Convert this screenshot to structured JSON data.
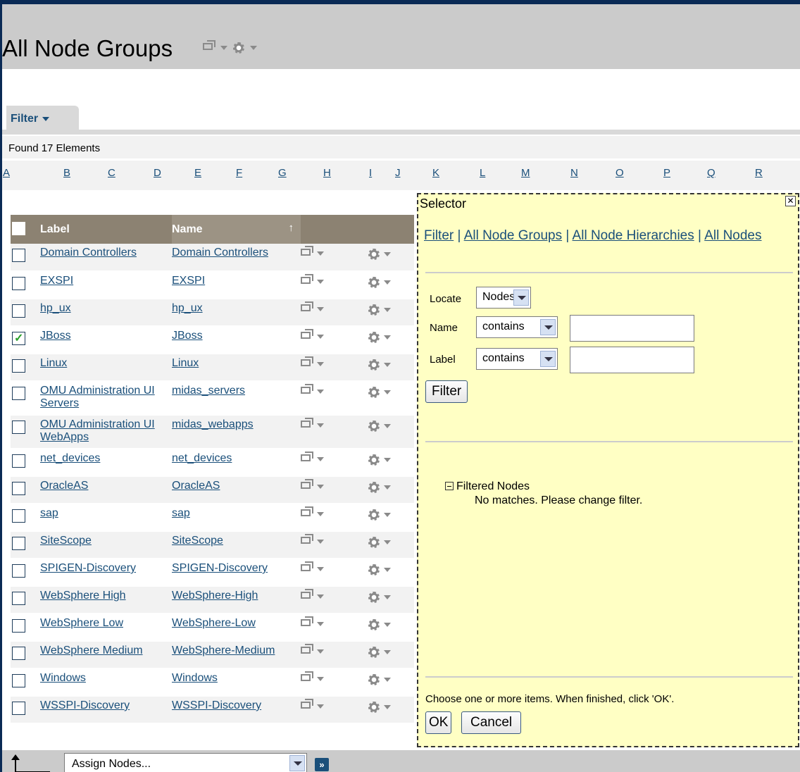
{
  "page": {
    "title": "All Node Groups",
    "filter_tab": "Filter",
    "found_text": "Found 17 Elements"
  },
  "alphabet": [
    "A",
    "B",
    "C",
    "D",
    "E",
    "F",
    "G",
    "H",
    "I",
    "J",
    "K",
    "L",
    "M",
    "N",
    "O",
    "P",
    "Q",
    "R"
  ],
  "table": {
    "headers": {
      "label": "Label",
      "name": "Name"
    },
    "sort_indicator": "↑",
    "rows": [
      {
        "label": "Domain Controllers",
        "name": "Domain Controllers",
        "checked": false
      },
      {
        "label": "EXSPI",
        "name": "EXSPI",
        "checked": false
      },
      {
        "label": "hp_ux",
        "name": "hp_ux",
        "checked": false
      },
      {
        "label": "JBoss",
        "name": "JBoss",
        "checked": true
      },
      {
        "label": "Linux",
        "name": "Linux",
        "checked": false
      },
      {
        "label": "OMU Administration UI Servers",
        "name": "midas_servers",
        "checked": false
      },
      {
        "label": "OMU Administration UI WebApps",
        "name": "midas_webapps",
        "checked": false
      },
      {
        "label": "net_devices",
        "name": "net_devices",
        "checked": false
      },
      {
        "label": "OracleAS",
        "name": "OracleAS",
        "checked": false
      },
      {
        "label": "sap",
        "name": "sap",
        "checked": false
      },
      {
        "label": "SiteScope",
        "name": "SiteScope",
        "checked": false
      },
      {
        "label": "SPIGEN-Discovery",
        "name": "SPIGEN-Discovery",
        "checked": false
      },
      {
        "label": "WebSphere High",
        "name": "WebSphere-High",
        "checked": false
      },
      {
        "label": "WebSphere Low",
        "name": "WebSphere-Low",
        "checked": false
      },
      {
        "label": "WebSphere Medium",
        "name": "WebSphere-Medium",
        "checked": false
      },
      {
        "label": "Windows",
        "name": "Windows",
        "checked": false
      },
      {
        "label": "WSSPI-Discovery",
        "name": "WSSPI-Discovery",
        "checked": false
      }
    ]
  },
  "selector": {
    "title": "Selector",
    "close": "✕",
    "links": [
      "Filter",
      "All Node Groups",
      "All Node Hierarchies",
      "All Nodes"
    ],
    "separator": " | ",
    "locate_label": "Locate",
    "locate_value": "Nodes",
    "name_label": "Name",
    "name_op": "contains",
    "name_value": "",
    "label_label": "Label",
    "label_op": "contains",
    "label_value": "",
    "filter_button": "Filter",
    "tree_root": "Filtered Nodes",
    "tree_message": "No matches. Please change filter.",
    "hint": "Choose one or more items. When finished, click 'OK'.",
    "ok_button": "OK",
    "cancel_button": "Cancel"
  },
  "footer": {
    "action_select": "Assign Nodes...",
    "go_button": "»"
  }
}
